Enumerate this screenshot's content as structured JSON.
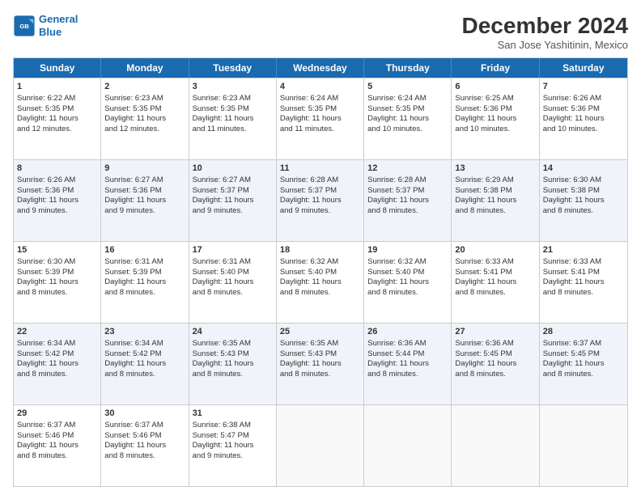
{
  "logo": {
    "line1": "General",
    "line2": "Blue"
  },
  "title": "December 2024",
  "subtitle": "San Jose Yashitinin, Mexico",
  "days": [
    "Sunday",
    "Monday",
    "Tuesday",
    "Wednesday",
    "Thursday",
    "Friday",
    "Saturday"
  ],
  "weeks": [
    [
      {
        "day": "1",
        "sunrise": "6:22 AM",
        "sunset": "5:35 PM",
        "daylight": "11 hours and 12 minutes."
      },
      {
        "day": "2",
        "sunrise": "6:23 AM",
        "sunset": "5:35 PM",
        "daylight": "11 hours and 12 minutes."
      },
      {
        "day": "3",
        "sunrise": "6:23 AM",
        "sunset": "5:35 PM",
        "daylight": "11 hours and 11 minutes."
      },
      {
        "day": "4",
        "sunrise": "6:24 AM",
        "sunset": "5:35 PM",
        "daylight": "11 hours and 11 minutes."
      },
      {
        "day": "5",
        "sunrise": "6:24 AM",
        "sunset": "5:35 PM",
        "daylight": "11 hours and 10 minutes."
      },
      {
        "day": "6",
        "sunrise": "6:25 AM",
        "sunset": "5:36 PM",
        "daylight": "11 hours and 10 minutes."
      },
      {
        "day": "7",
        "sunrise": "6:26 AM",
        "sunset": "5:36 PM",
        "daylight": "11 hours and 10 minutes."
      }
    ],
    [
      {
        "day": "8",
        "sunrise": "6:26 AM",
        "sunset": "5:36 PM",
        "daylight": "11 hours and 9 minutes."
      },
      {
        "day": "9",
        "sunrise": "6:27 AM",
        "sunset": "5:36 PM",
        "daylight": "11 hours and 9 minutes."
      },
      {
        "day": "10",
        "sunrise": "6:27 AM",
        "sunset": "5:37 PM",
        "daylight": "11 hours and 9 minutes."
      },
      {
        "day": "11",
        "sunrise": "6:28 AM",
        "sunset": "5:37 PM",
        "daylight": "11 hours and 9 minutes."
      },
      {
        "day": "12",
        "sunrise": "6:28 AM",
        "sunset": "5:37 PM",
        "daylight": "11 hours and 8 minutes."
      },
      {
        "day": "13",
        "sunrise": "6:29 AM",
        "sunset": "5:38 PM",
        "daylight": "11 hours and 8 minutes."
      },
      {
        "day": "14",
        "sunrise": "6:30 AM",
        "sunset": "5:38 PM",
        "daylight": "11 hours and 8 minutes."
      }
    ],
    [
      {
        "day": "15",
        "sunrise": "6:30 AM",
        "sunset": "5:39 PM",
        "daylight": "11 hours and 8 minutes."
      },
      {
        "day": "16",
        "sunrise": "6:31 AM",
        "sunset": "5:39 PM",
        "daylight": "11 hours and 8 minutes."
      },
      {
        "day": "17",
        "sunrise": "6:31 AM",
        "sunset": "5:40 PM",
        "daylight": "11 hours and 8 minutes."
      },
      {
        "day": "18",
        "sunrise": "6:32 AM",
        "sunset": "5:40 PM",
        "daylight": "11 hours and 8 minutes."
      },
      {
        "day": "19",
        "sunrise": "6:32 AM",
        "sunset": "5:40 PM",
        "daylight": "11 hours and 8 minutes."
      },
      {
        "day": "20",
        "sunrise": "6:33 AM",
        "sunset": "5:41 PM",
        "daylight": "11 hours and 8 minutes."
      },
      {
        "day": "21",
        "sunrise": "6:33 AM",
        "sunset": "5:41 PM",
        "daylight": "11 hours and 8 minutes."
      }
    ],
    [
      {
        "day": "22",
        "sunrise": "6:34 AM",
        "sunset": "5:42 PM",
        "daylight": "11 hours and 8 minutes."
      },
      {
        "day": "23",
        "sunrise": "6:34 AM",
        "sunset": "5:42 PM",
        "daylight": "11 hours and 8 minutes."
      },
      {
        "day": "24",
        "sunrise": "6:35 AM",
        "sunset": "5:43 PM",
        "daylight": "11 hours and 8 minutes."
      },
      {
        "day": "25",
        "sunrise": "6:35 AM",
        "sunset": "5:43 PM",
        "daylight": "11 hours and 8 minutes."
      },
      {
        "day": "26",
        "sunrise": "6:36 AM",
        "sunset": "5:44 PM",
        "daylight": "11 hours and 8 minutes."
      },
      {
        "day": "27",
        "sunrise": "6:36 AM",
        "sunset": "5:45 PM",
        "daylight": "11 hours and 8 minutes."
      },
      {
        "day": "28",
        "sunrise": "6:37 AM",
        "sunset": "5:45 PM",
        "daylight": "11 hours and 8 minutes."
      }
    ],
    [
      {
        "day": "29",
        "sunrise": "6:37 AM",
        "sunset": "5:46 PM",
        "daylight": "11 hours and 8 minutes."
      },
      {
        "day": "30",
        "sunrise": "6:37 AM",
        "sunset": "5:46 PM",
        "daylight": "11 hours and 8 minutes."
      },
      {
        "day": "31",
        "sunrise": "6:38 AM",
        "sunset": "5:47 PM",
        "daylight": "11 hours and 9 minutes."
      },
      null,
      null,
      null,
      null
    ]
  ],
  "labels": {
    "sunrise": "Sunrise:",
    "sunset": "Sunset:",
    "daylight": "Daylight:"
  }
}
